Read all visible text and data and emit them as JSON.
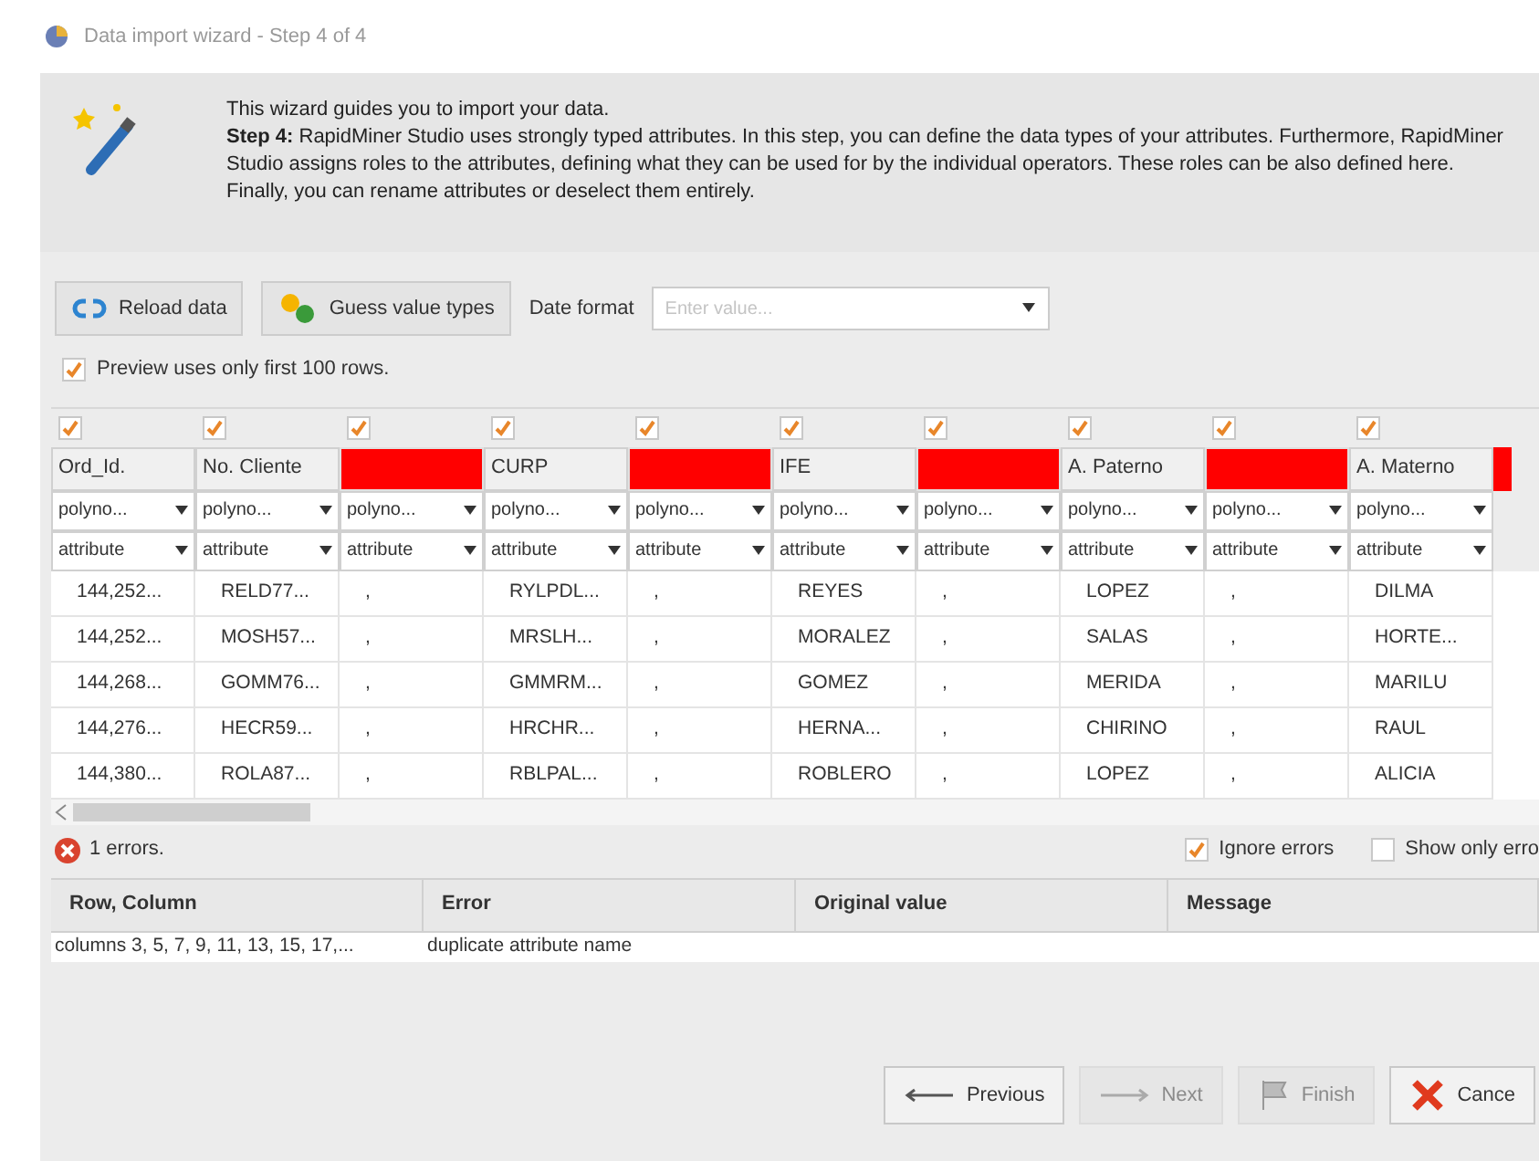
{
  "window": {
    "title": "Data import wizard - Step 4 of 4"
  },
  "intro": {
    "line_1": "This wizard guides you to import your data.",
    "text": "**Step 4:** RapidMiner Studio uses strongly typed attributes. In this step, you can define the data types of your attributes. Furthermore, RapidMiner Studio assigns roles to the attributes, defining what they can be used for by the individual operators. These roles can be also defined here. Finally, you can rename attributes or deselect them entirely."
  },
  "toolbar": {
    "reload": "Reload data",
    "guess": "Guess value types",
    "date_label": "Date format",
    "date_placeholder": "Enter value..."
  },
  "preview": {
    "label": "Preview uses only first 100 rows.",
    "checked": true
  },
  "columns": [
    {
      "name": "Ord_Id.",
      "error": false,
      "checked": true,
      "type": "polyno...",
      "role": "attribute"
    },
    {
      "name": "No. Cliente",
      "error": false,
      "checked": true,
      "type": "polyno...",
      "role": "attribute"
    },
    {
      "error": true,
      "checked": true,
      "type": "polyno...",
      "role": "attribute"
    },
    {
      "name": "CURP",
      "error": false,
      "checked": true,
      "type": "polyno...",
      "role": "attribute"
    },
    {
      "error": true,
      "checked": true,
      "type": "polyno...",
      "role": "attribute"
    },
    {
      "name": "IFE",
      "error": false,
      "checked": true,
      "type": "polyno...",
      "role": "attribute"
    },
    {
      "error": true,
      "checked": true,
      "type": "polyno...",
      "role": "attribute"
    },
    {
      "name": "A. Paterno",
      "error": false,
      "checked": true,
      "type": "polyno...",
      "role": "attribute"
    },
    {
      "error": true,
      "checked": true,
      "type": "polyno...",
      "role": "attribute"
    },
    {
      "name": "A. Materno",
      "error": false,
      "checked": true,
      "type": "polyno...",
      "role": "attribute"
    }
  ],
  "rows": [
    [
      "144,252...",
      "RELD77...",
      ",",
      "RYLPDL...",
      ",",
      "REYES",
      ",",
      "LOPEZ",
      ",",
      "DILMA"
    ],
    [
      "144,252...",
      "MOSH57...",
      ",",
      "MRSLH...",
      ",",
      "MORALEZ",
      ",",
      "SALAS",
      ",",
      "HORTE..."
    ],
    [
      "144,268...",
      "GOMM76...",
      ",",
      "GMMRM...",
      ",",
      "GOMEZ",
      ",",
      "MERIDA",
      ",",
      "MARILU"
    ],
    [
      "144,276...",
      "HECR59...",
      ",",
      "HRCHR...",
      ",",
      "HERNA...",
      ",",
      "CHIRINO",
      ",",
      "RAUL"
    ],
    [
      "144,380...",
      "ROLA87...",
      ",",
      "RBLPAL...",
      ",",
      "ROBLERO",
      ",",
      "LOPEZ",
      ",",
      "ALICIA"
    ]
  ],
  "errors": {
    "count": "1 errors.",
    "ignore": {
      "label": "Ignore errors",
      "checked": true
    },
    "show_only": {
      "label": "Show only erro",
      "checked": false
    },
    "columns": [
      "Row, Column",
      "Error",
      "Original value",
      "Message"
    ],
    "rows": [
      [
        "columns 3, 5, 7, 9, 11, 13, 15, 17,...",
        "duplicate attribute name",
        "",
        ""
      ]
    ]
  },
  "buttons": [
    {
      "label": "Previous",
      "kind": "previous",
      "disabled": false
    },
    {
      "label": "Next",
      "kind": "next",
      "disabled": true
    },
    {
      "label": "Finish",
      "kind": "finish",
      "disabled": true
    },
    {
      "label": "Cance",
      "kind": "cancel",
      "disabled": false
    }
  ]
}
